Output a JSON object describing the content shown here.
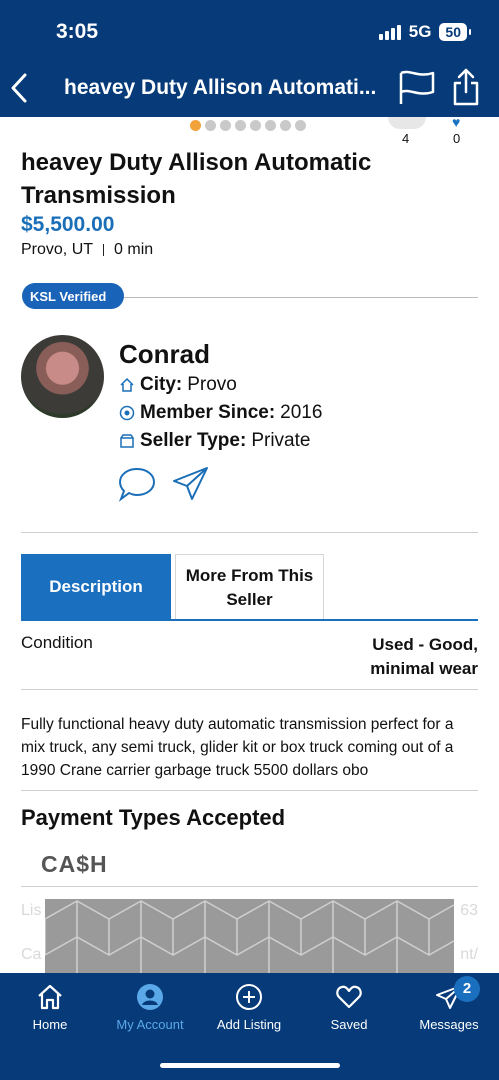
{
  "status": {
    "time": "3:05",
    "network": "5G",
    "battery": "50"
  },
  "nav": {
    "title": "heavey Duty Allison Automati..."
  },
  "gallery": {
    "count_a": "4",
    "count_b": "0"
  },
  "listing": {
    "title": "heavey Duty Allison Automatic Transmission",
    "price": "$5,500.00",
    "city": "Provo, UT",
    "time": "0 min",
    "verified_badge": "KSL Verified"
  },
  "seller": {
    "name": "Conrad",
    "city_label": "City:",
    "city_value": "Provo",
    "member_label": "Member Since:",
    "member_value": "2016",
    "type_label": "Seller Type:",
    "type_value": "Private"
  },
  "tabs": {
    "description": "Description",
    "more": "More From This Seller"
  },
  "condition": {
    "label": "Condition",
    "value": "Used - Good, minimal wear"
  },
  "description": "Fully functional heavy duty automatic transmission perfect for a mix truck, any semi truck, glider kit or box truck coming out of a 1990 Crane carrier garbage truck 5500 dollars obo",
  "payment": {
    "heading": "Payment Types Accepted",
    "cash": "CA$H"
  },
  "ghost": {
    "a": "Lis",
    "b": "Ca",
    "c": "63",
    "d": "nt/"
  },
  "tabbar": {
    "home": "Home",
    "account": "My Account",
    "add": "Add Listing",
    "saved": "Saved",
    "messages": "Messages",
    "messages_badge": "2"
  },
  "colors": {
    "brand_navy": "#063a78",
    "accent_blue": "#1a6fbe",
    "verified_green": "#3fc76d"
  }
}
